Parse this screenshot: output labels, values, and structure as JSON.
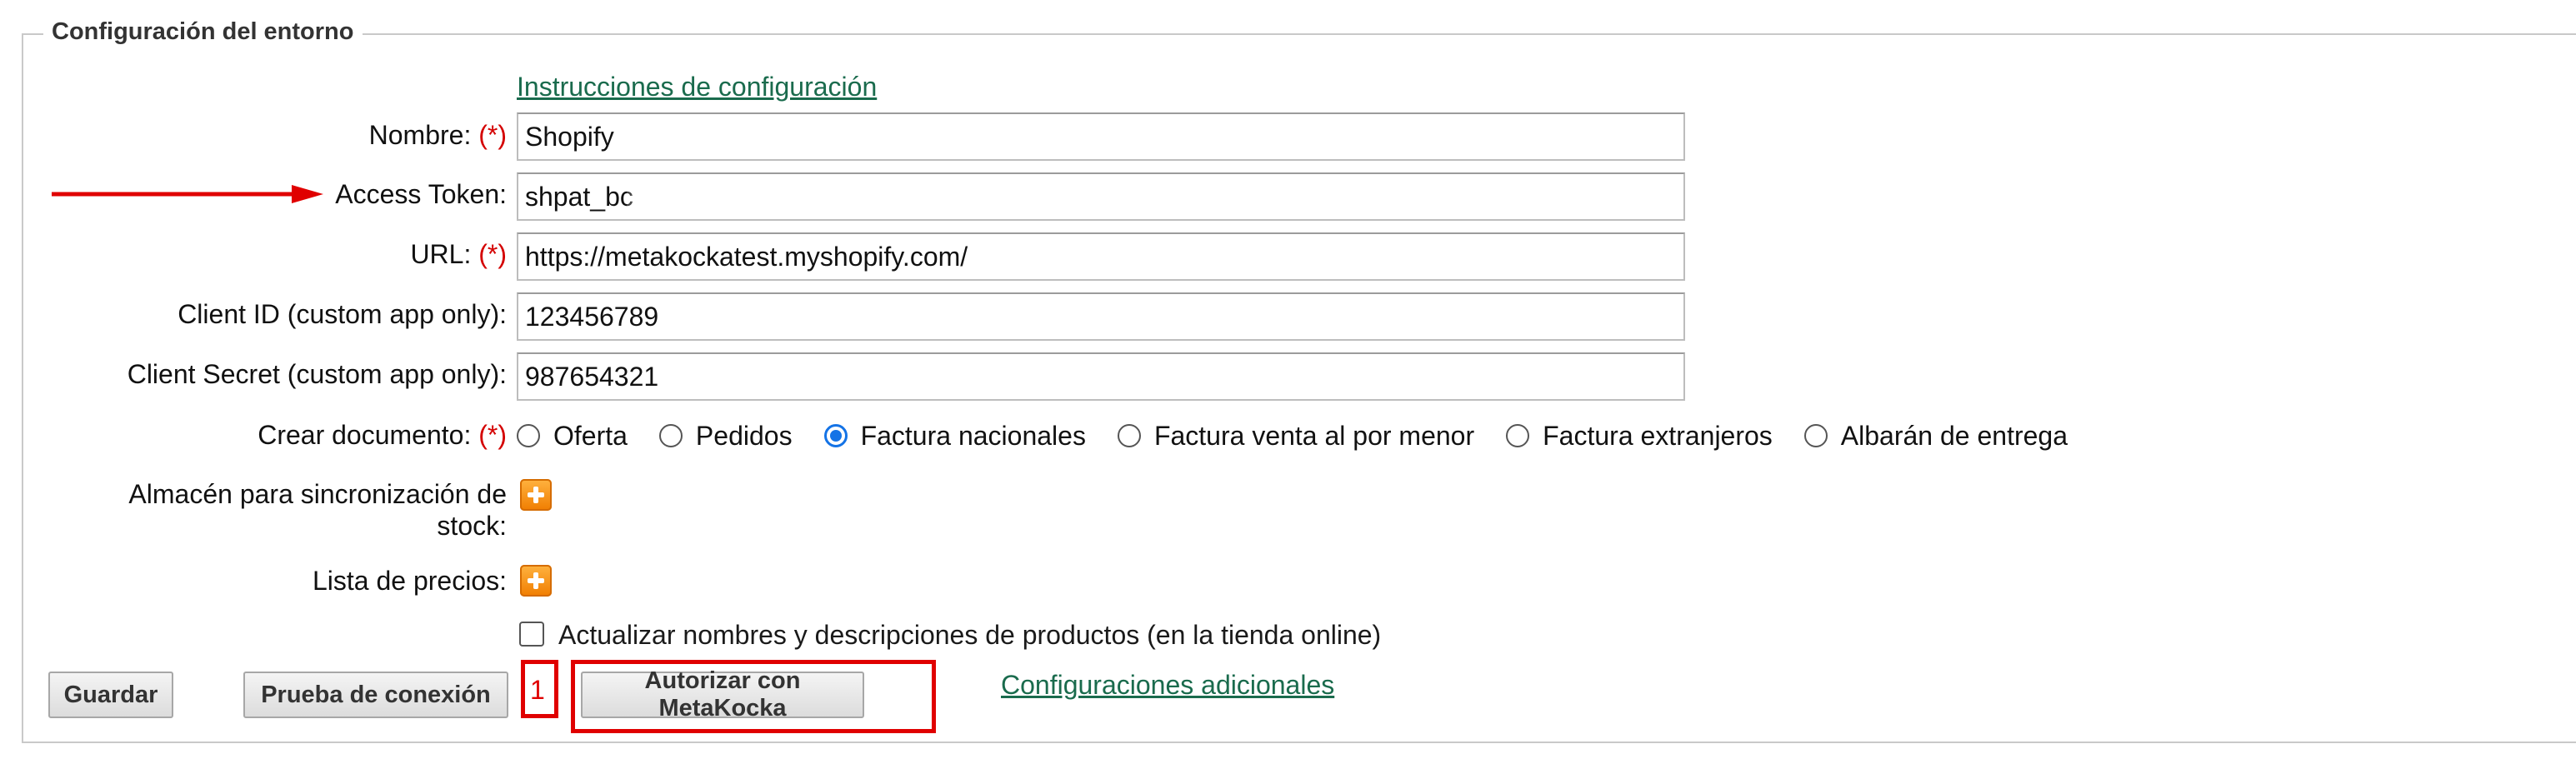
{
  "legend": "Configuración del entorno",
  "instructions_link": "Instrucciones de configuración",
  "required_mark": "(*)",
  "fields": {
    "nombre": {
      "label": "Nombre:",
      "value": "Shopify"
    },
    "access_token": {
      "label": "Access Token:",
      "value": "shpat_bc"
    },
    "url": {
      "label": "URL:",
      "value": "https://metakockatest.myshopify.com/"
    },
    "client_id": {
      "label": "Client ID (custom app only):",
      "value": "123456789"
    },
    "client_secret": {
      "label": "Client Secret (custom app only):",
      "value": "987654321"
    }
  },
  "crear_documento": {
    "label": "Crear documento:",
    "options": [
      "Oferta",
      "Pedidos",
      "Factura nacionales",
      "Factura venta al por menor",
      "Factura extranjeros",
      "Albarán de entrega"
    ],
    "selected": "Factura nacionales"
  },
  "almacen": {
    "label_line1": "Almacén para sincronización de",
    "label_line2": "stock:"
  },
  "lista_precios": {
    "label": "Lista de precios:"
  },
  "checkbox": {
    "label": "Actualizar nombres y descripciones de productos (en la tienda online)",
    "checked": false
  },
  "buttons": {
    "guardar": "Guardar",
    "prueba": "Prueba de conexión",
    "autorizar": "Autorizar con MetaKocka"
  },
  "annotation_number": "1",
  "additional_link": "Configuraciones adicionales",
  "colors": {
    "link": "#1a6b4d",
    "required": "#d40000",
    "annotation": "#e00000",
    "radio_selected": "#1473e6",
    "plus_icon": "#f07d00"
  },
  "icons": {
    "add": "plus-square-icon",
    "pointer": "red-arrow-icon"
  }
}
